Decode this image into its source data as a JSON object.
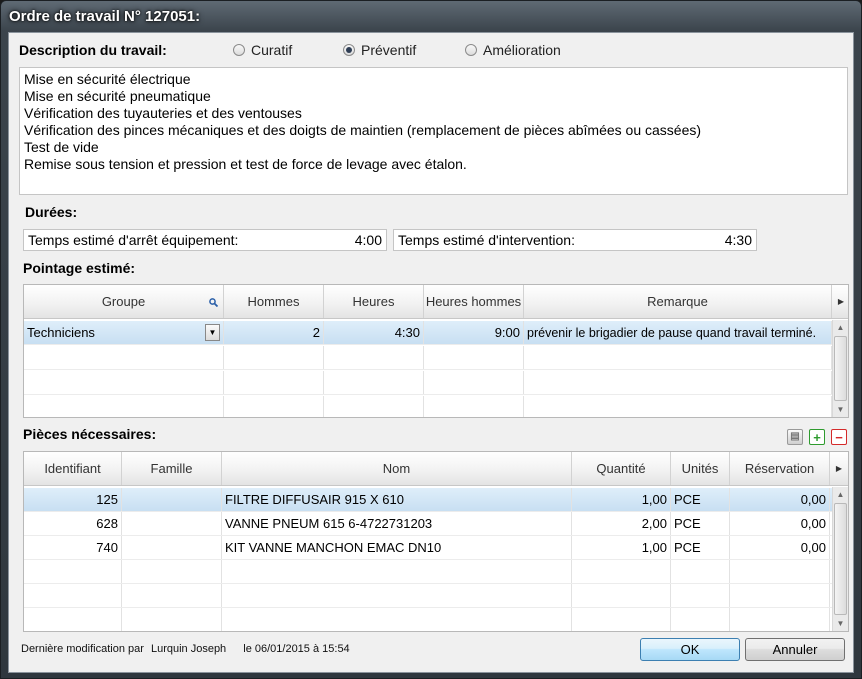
{
  "window": {
    "title": "Ordre de travail N° 127051:"
  },
  "description": {
    "label": "Description du travail:",
    "radios": [
      {
        "label": "Curatif",
        "checked": false
      },
      {
        "label": "Préventif",
        "checked": true
      },
      {
        "label": "Amélioration",
        "checked": false
      }
    ],
    "lines": [
      "Mise en sécurité électrique",
      "Mise en sécurité pneumatique",
      "Vérification des tuyauteries et des ventouses",
      "Vérification des pinces mécaniques et des doigts de maintien (remplacement de pièces abîmées ou cassées)",
      "Test de vide",
      "Remise sous tension et pression et test de force de levage avec étalon."
    ]
  },
  "durees": {
    "label": "Durées:",
    "arret_label": "Temps estimé d'arrêt équipement:",
    "arret_value": "4:00",
    "intervention_label": "Temps estimé d'intervention:",
    "intervention_value": "4:30"
  },
  "pointage": {
    "label": "Pointage estimé:",
    "headers": [
      "Groupe",
      "Hommes",
      "Heures",
      "Heures hommes",
      "Remarque"
    ],
    "row": {
      "groupe": "Techniciens",
      "hommes": "2",
      "heures": "4:30",
      "heures_hommes": "9:00",
      "remarque": "prévenir le brigadier de pause quand travail terminé."
    }
  },
  "pieces": {
    "label": "Pièces nécessaires:",
    "headers": [
      "Identifiant",
      "Famille",
      "Nom",
      "Quantité",
      "Unités",
      "Réservation"
    ],
    "rows": [
      {
        "id": "125",
        "famille": "",
        "nom": "FILTRE DIFFUSAIR 915 X 610",
        "quantite": "1,00",
        "unites": "PCE",
        "reservation": "0,00"
      },
      {
        "id": "628",
        "famille": "",
        "nom": "VANNE PNEUM 615 6-4722731203",
        "quantite": "2,00",
        "unites": "PCE",
        "reservation": "0,00"
      },
      {
        "id": "740",
        "famille": "",
        "nom": "KIT VANNE MANCHON EMAC DN10",
        "quantite": "1,00",
        "unites": "PCE",
        "reservation": "0,00"
      }
    ]
  },
  "footer": {
    "modif_label": "Dernière modification par",
    "user": "Lurquin Joseph",
    "date": "le 06/01/2015 à 15:54",
    "ok": "OK",
    "cancel": "Annuler"
  },
  "colors": {
    "selected_row": "#c8dff2",
    "add": "#2e9b2e",
    "remove": "#d42a2a"
  },
  "icons": [
    "search-icon",
    "dropdown-arrow-icon",
    "column-chooser-icon",
    "add-icon",
    "remove-icon",
    "print-icon"
  ]
}
